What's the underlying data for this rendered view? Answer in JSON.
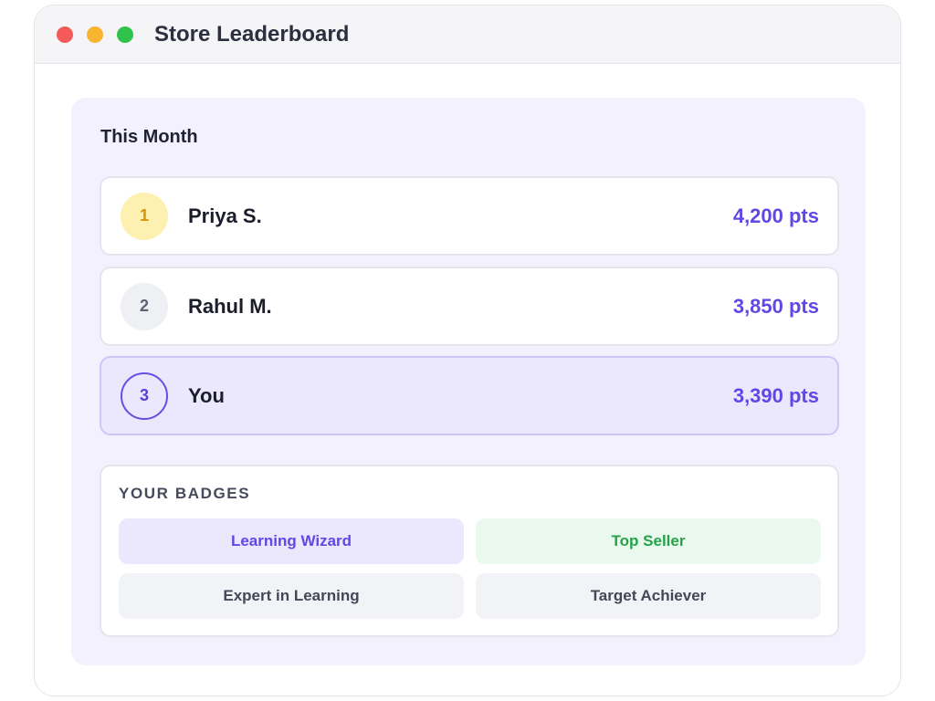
{
  "window": {
    "title": "Store Leaderboard"
  },
  "leaderboard": {
    "period_label": "This Month",
    "entries": [
      {
        "rank": "1",
        "name": "Priya S.",
        "points": "4,200 pts"
      },
      {
        "rank": "2",
        "name": "Rahul M.",
        "points": "3,850 pts"
      },
      {
        "rank": "3",
        "name": "You",
        "points": "3,390 pts"
      }
    ]
  },
  "badges": {
    "heading": "YOUR BADGES",
    "items": [
      {
        "label": "Learning Wizard"
      },
      {
        "label": "Top Seller"
      },
      {
        "label": "Expert in Learning"
      },
      {
        "label": "Target Achiever"
      }
    ]
  },
  "colors": {
    "accent": "#6246e6",
    "gold": "#d4940b",
    "success": "#24a348"
  }
}
